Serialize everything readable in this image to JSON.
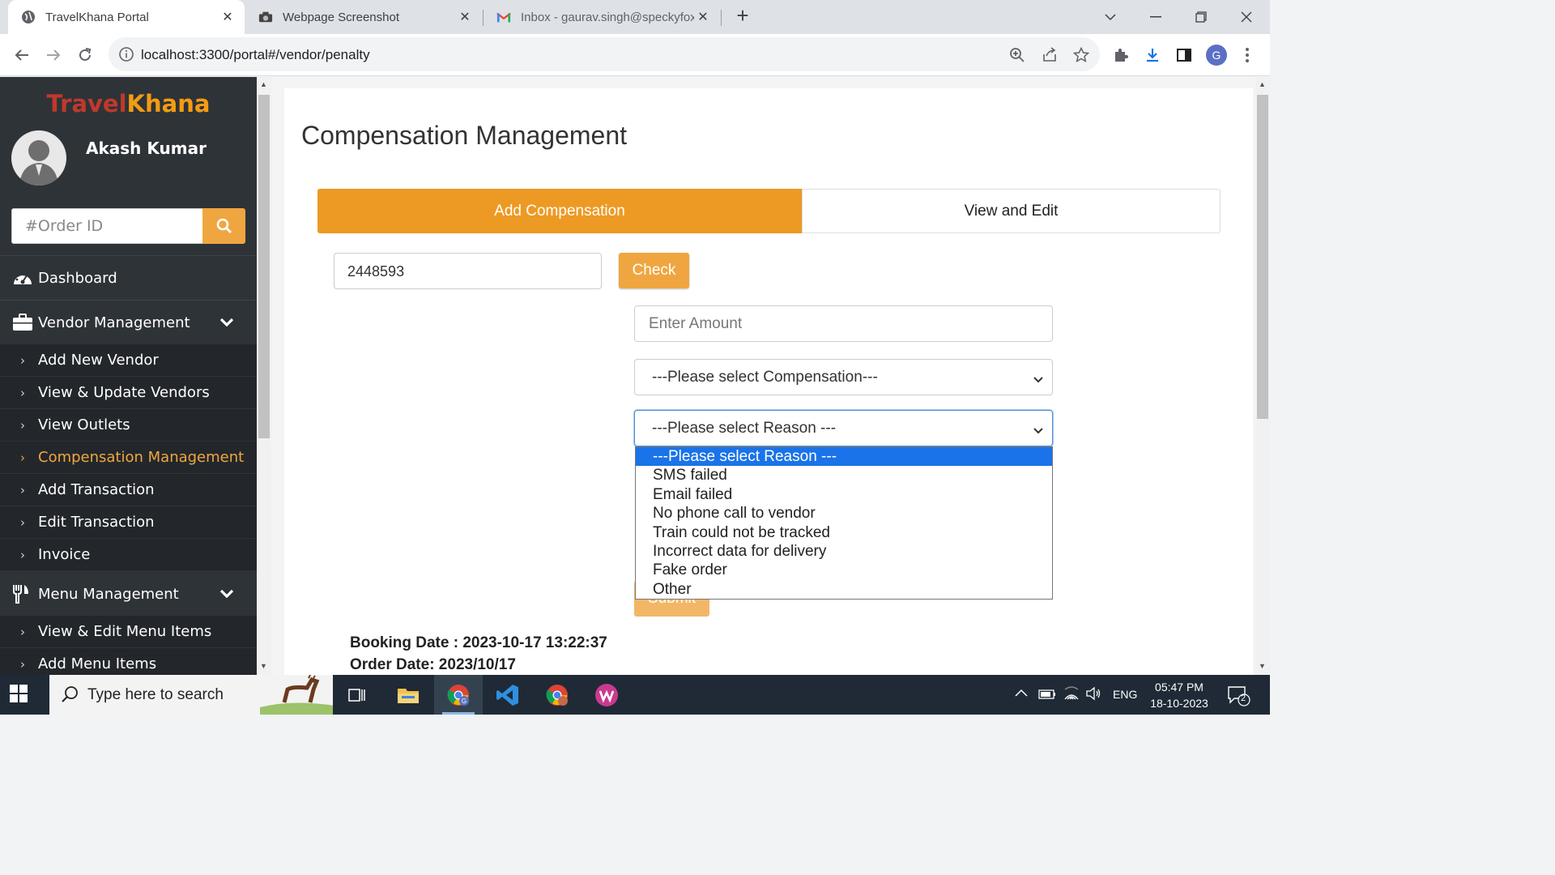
{
  "browser": {
    "tabs": [
      {
        "title": "TravelKhana Portal",
        "active": true
      },
      {
        "title": "Webpage Screenshot",
        "active": false
      },
      {
        "title": "Inbox - gaurav.singh@speckyfox",
        "active": false
      }
    ],
    "url": "localhost:3300/portal#/vendor/penalty",
    "profile_initial": "G"
  },
  "sidebar": {
    "brand_part1": "Travel",
    "brand_part2": "Khana",
    "user_name": "Akash Kumar",
    "search_placeholder": "#Order ID",
    "dashboard": "Dashboard",
    "vendor_management": "Vendor Management",
    "vendor_items": [
      {
        "label": "Add New Vendor",
        "active": false
      },
      {
        "label": "View & Update Vendors",
        "active": false
      },
      {
        "label": "View Outlets",
        "active": false
      },
      {
        "label": "Compensation Management",
        "active": true
      },
      {
        "label": "Add Transaction",
        "active": false
      },
      {
        "label": "Edit Transaction",
        "active": false
      },
      {
        "label": "Invoice",
        "active": false
      }
    ],
    "menu_management": "Menu Management",
    "menu_items": [
      {
        "label": "View & Edit Menu Items"
      },
      {
        "label": "Add Menu Items"
      }
    ]
  },
  "main": {
    "title": "Compensation Management",
    "tab_add": "Add Compensation",
    "tab_view": "View and Edit",
    "order_id_value": "2448593",
    "check_label": "Check",
    "amount_placeholder": "Enter Amount",
    "compensation_select": "---Please select Compensation---",
    "reason_select": "---Please select Reason ---",
    "reason_options": [
      "---Please select Reason ---",
      "SMS failed",
      "Email failed",
      "No phone call to vendor",
      "Train could not be tracked",
      "Incorrect data for delivery",
      "Fake order",
      "Other"
    ],
    "reason_selected_index": 0,
    "submit_label": "Submit",
    "booking_date": "Booking Date : 2023-10-17 13:22:37",
    "order_date": "Order Date: 2023/10/17"
  },
  "taskbar": {
    "search_placeholder": "Type here to search",
    "language": "ENG",
    "time": "05:47 PM",
    "date": "18-10-2023",
    "notification_count": "2"
  },
  "colors": {
    "accent_orange": "#ed9a24",
    "sidebar_bg": "#2e3338",
    "active_menu": "#f0a640",
    "dropdown_highlight": "#1a73e8"
  }
}
